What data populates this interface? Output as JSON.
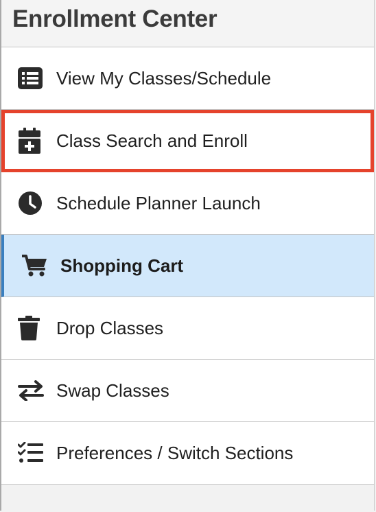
{
  "header": {
    "title": "Enrollment Center"
  },
  "nav": {
    "items": [
      {
        "label": "View My Classes/Schedule",
        "icon": "list-icon"
      },
      {
        "label": "Class Search and Enroll",
        "icon": "calendar-plus-icon"
      },
      {
        "label": "Schedule Planner Launch",
        "icon": "clock-icon"
      },
      {
        "label": "Shopping Cart",
        "icon": "cart-icon"
      },
      {
        "label": "Drop Classes",
        "icon": "trash-icon"
      },
      {
        "label": "Swap Classes",
        "icon": "swap-arrows-icon"
      },
      {
        "label": "Preferences / Switch Sections",
        "icon": "checklist-icon"
      }
    ],
    "highlighted_item": "Class Search and Enroll",
    "active_item": "Shopping Cart"
  },
  "colors": {
    "highlight_border": "#e5432c",
    "active_background": "#d2e8fb",
    "active_accent": "#3a7fbf",
    "icon": "#2b2b2b"
  }
}
